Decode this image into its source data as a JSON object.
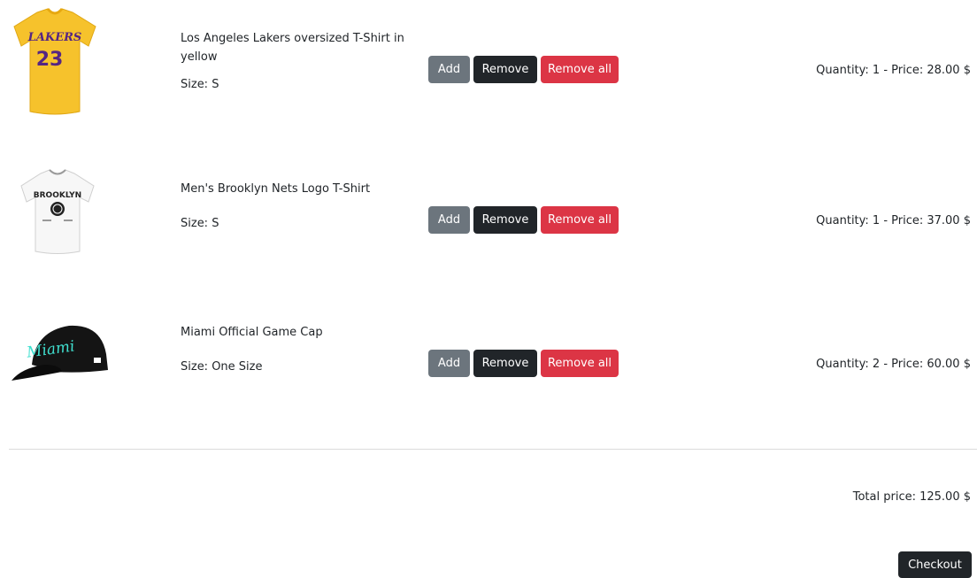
{
  "cart": {
    "items": [
      {
        "name": "Los Angeles Lakers oversized T-Shirt in yellow",
        "size": "Size: S",
        "image": "lakers-yellow-tshirt-image",
        "image_number": "23",
        "image_wordmark": "LAKERS",
        "add_label": "Add",
        "remove_label": "Remove",
        "remove_all_label": "Remove all",
        "summary": "Quantity: 1 - Price: 28.00 $"
      },
      {
        "name": "Men's Brooklyn Nets Logo T-Shirt",
        "size": "Size: S",
        "image": "nets-white-tshirt-image",
        "image_wordmark": "BROOKLYN",
        "add_label": "Add",
        "remove_label": "Remove",
        "remove_all_label": "Remove all",
        "summary": "Quantity: 1 - Price: 37.00 $"
      },
      {
        "name": "Miami Official Game Cap",
        "size": "Size: One Size",
        "image": "miami-black-cap-image",
        "image_wordmark": "Miami",
        "add_label": "Add",
        "remove_label": "Remove",
        "remove_all_label": "Remove all",
        "summary": "Quantity: 2 - Price: 60.00 $"
      }
    ],
    "total": "Total price: 125.00 $",
    "checkout_label": "Checkout"
  },
  "colors": {
    "add": "#6c757d",
    "remove": "#212529",
    "remove_all": "#dc3545",
    "lakers_gold": "#fdb927",
    "lakers_purple": "#552583",
    "miami_cyan": "#40e0d0"
  }
}
